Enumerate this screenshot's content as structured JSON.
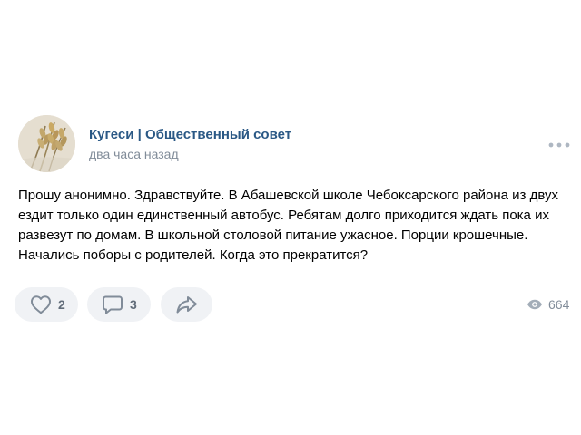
{
  "post": {
    "author": "Кугеси | Общественный совет",
    "time": "два часа назад",
    "text": "Прошу анонимно. Здравствуйте. В Абашевской школе Чебоксарского района из двух ездит только один единственный автобус. Ребятам долго приходится ждать пока их развезут по домам. В школьной столовой питание ужасное. Порции крошечные. Начались поборы с родителей. Когда это прекратится?",
    "avatar_icon": "wheat-ears-icon",
    "more_icon": "more-horizontal-icon"
  },
  "actions": {
    "like": {
      "icon": "heart-icon",
      "count": "2"
    },
    "comment": {
      "icon": "comment-icon",
      "count": "3"
    },
    "share": {
      "icon": "share-arrow-icon"
    }
  },
  "views": {
    "icon": "eye-icon",
    "count": "664"
  },
  "colors": {
    "author_link": "#2a5885",
    "secondary_text": "#818c99",
    "button_background": "#f0f2f5",
    "icon": "#818c99"
  }
}
